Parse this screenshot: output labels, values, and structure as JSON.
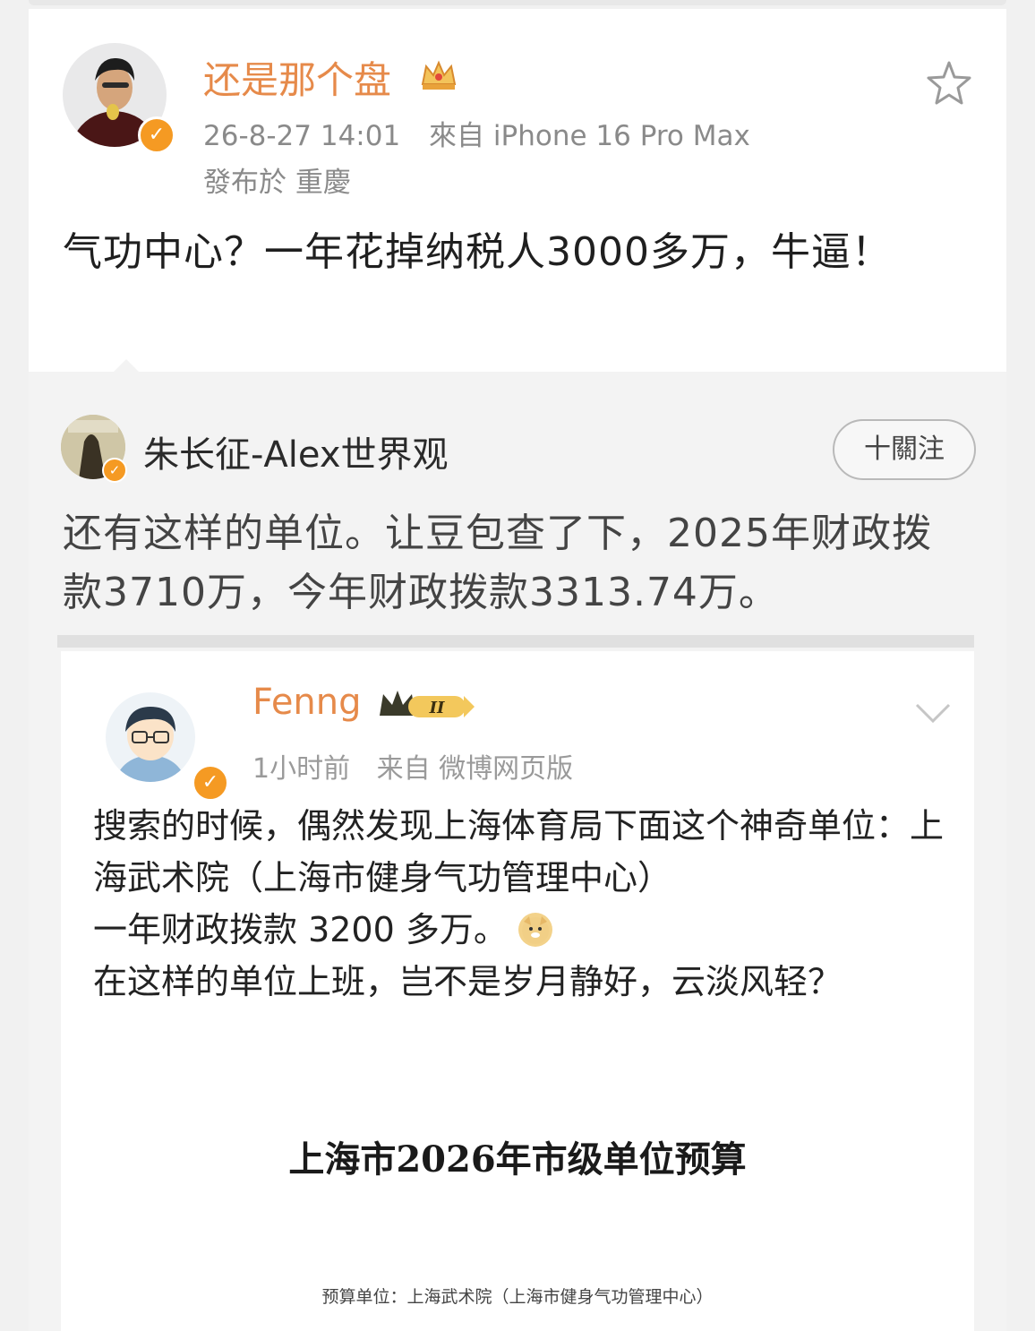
{
  "post": {
    "author": "还是那个盘",
    "timestamp": "26-8-27 14:01",
    "source": "來自 iPhone 16 Pro Max",
    "location": "發布於 重慶",
    "text": "气功中心？一年花掉纳税人3000多万，牛逼！"
  },
  "repost": {
    "author": "朱长征-Alex世界观",
    "follow_label": "十關注",
    "text": "还有这样的单位。让豆包查了下，2025年财政拨款3710万，今年财政拨款3313.74万。"
  },
  "quoted": {
    "author": "Fenng",
    "badge_level": "II",
    "time": "1小时前",
    "source": "来自 微博网页版",
    "line1": "搜索的时候，偶然发现上海体育局下面这个神奇单位：上海武术院（上海市健身气功管理中心）",
    "line2": "一年财政拨款 3200 多万。",
    "line3": "在这样的单位上班，岂不是岁月静好，云淡风轻？",
    "doc_title": "上海市2026年市级单位预算",
    "doc_subtitle": "预算单位：上海武术院（上海市健身气功管理中心）"
  },
  "colors": {
    "accent_orange": "#e68a4a",
    "verified_orange": "#f59a23",
    "meta_gray": "#8a8a8a"
  },
  "icons": {
    "crown": "crown-icon",
    "star": "star-icon",
    "verified": "verified-icon",
    "chevron": "chevron-down-icon",
    "emoji": "doge-emoji-icon"
  }
}
